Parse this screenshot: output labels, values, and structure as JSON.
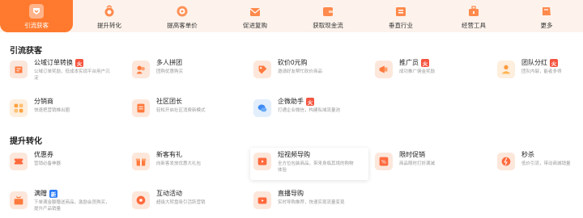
{
  "colors": {
    "accent": "#ff7a2e",
    "nav_bg": "#fdf3ec",
    "tag_hot": "#f5543f",
    "tag_new": "#2b7cf6"
  },
  "nav": {
    "items": [
      {
        "label": "引流获客",
        "icon": "magnet-icon",
        "active": true
      },
      {
        "label": "提升转化",
        "icon": "ring-icon",
        "active": false
      },
      {
        "label": "提高客单价",
        "icon": "coin-icon",
        "active": false
      },
      {
        "label": "促进复购",
        "icon": "envelope-icon",
        "active": false
      },
      {
        "label": "获取现金流",
        "icon": "wallet-icon",
        "active": false
      },
      {
        "label": "垂直行业",
        "icon": "store-icon",
        "active": false
      },
      {
        "label": "经营工具",
        "icon": "toolbox-icon",
        "active": false
      },
      {
        "label": "更多",
        "icon": "more-icon",
        "active": false
      }
    ]
  },
  "sections": [
    {
      "title": "引流获客"
    },
    {
      "title": "提升转化"
    }
  ],
  "cards": [
    {
      "title": "公域订单转换",
      "desc": "公域订单奖励，低成本实现平台用户沉淀",
      "tag": "hot",
      "icon": "order-convert-icon",
      "color": "#fbe6dc"
    },
    {
      "title": "多人拼团",
      "desc": "团购优惠购买",
      "tag": "",
      "icon": "group-buy-icon",
      "color": "#fde7db"
    },
    {
      "title": "砍价0元购",
      "desc": "邀请好友帮忙砍价商品",
      "tag": "",
      "icon": "bargain-icon",
      "color": "#fde7db"
    },
    {
      "title": "推广员",
      "desc": "成功推广佣金奖励",
      "tag": "hot",
      "icon": "promoter-icon",
      "color": "#fde7db"
    },
    {
      "title": "团队分红",
      "desc": "团队内裂，能者多得",
      "tag": "hot",
      "icon": "team-bonus-icon",
      "color": "#fdeedd"
    },
    {
      "title": "分销商",
      "desc": "快速把营销推出圈",
      "tag": "",
      "icon": "distributor-icon",
      "color": "#fdeedd"
    },
    {
      "title": "社区团长",
      "desc": "轻松开启社区消费新模式",
      "tag": "",
      "icon": "community-leader-icon",
      "color": "#fde7db"
    },
    {
      "title": "企微助手",
      "desc": "打通企业微信，构建私域流量池",
      "tag": "hot",
      "icon": "wecom-icon",
      "color": "#e2eefc"
    },
    {
      "title": "优惠券",
      "desc": "营销必备神器",
      "tag": "",
      "icon": "coupon-icon",
      "color": "#fde7db"
    },
    {
      "title": "新客有礼",
      "desc": "向新客发放优惠大礼包",
      "tag": "",
      "icon": "new-customer-gift-icon",
      "color": "#fde7db"
    },
    {
      "title": "短视频导购",
      "desc": "全方位包装商品，带来身临其境的购物体验",
      "tag": "",
      "icon": "video-guide-icon",
      "color": "#fde7db"
    },
    {
      "title": "限时促销",
      "desc": "商品限时打折满减",
      "tag": "",
      "icon": "flash-sale-icon",
      "color": "#fde7db"
    },
    {
      "title": "秒杀",
      "desc": "低价引流，带动商城销量",
      "tag": "",
      "icon": "seckill-icon",
      "color": "#fde7db"
    },
    {
      "title": "满赠",
      "desc": "下单满金额赠送商品，激励会员购买，提升产品销量",
      "tag": "new",
      "icon": "full-gift-icon",
      "color": "#fde7db"
    },
    {
      "title": "互动活动",
      "desc": "超级大转盘吸引活跃营销",
      "tag": "",
      "icon": "interactive-icon",
      "color": "#fde7db"
    },
    {
      "title": "直播导购",
      "desc": "实时导购推荐，快速实现流量变现",
      "tag": "",
      "icon": "live-guide-icon",
      "color": "#fde7db"
    }
  ],
  "tags": {
    "hot": "火",
    "new": "新"
  }
}
